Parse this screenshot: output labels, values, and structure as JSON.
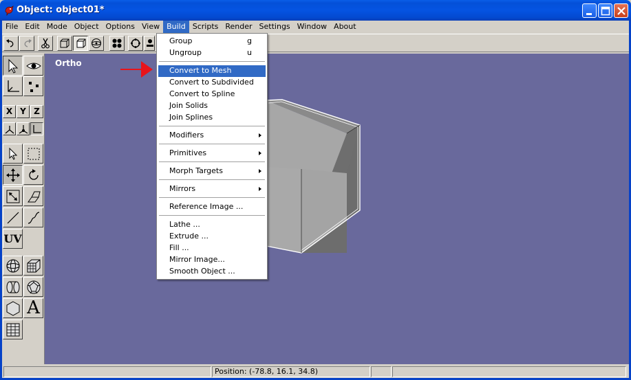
{
  "window": {
    "title": "Object: object01*",
    "icon": "bird-app-icon",
    "controls": [
      "minimize-icon",
      "maximize-icon",
      "close-icon"
    ]
  },
  "menubar": {
    "items": [
      {
        "label": "File"
      },
      {
        "label": "Edit"
      },
      {
        "label": "Mode"
      },
      {
        "label": "Object"
      },
      {
        "label": "Options"
      },
      {
        "label": "View"
      },
      {
        "label": "Build",
        "active": true
      },
      {
        "label": "Scripts"
      },
      {
        "label": "Render"
      },
      {
        "label": "Settings"
      },
      {
        "label": "Window"
      },
      {
        "label": "About"
      }
    ]
  },
  "toolbar": {
    "icons": [
      "undo-icon",
      "redo-icon",
      "scissors-icon",
      "box-view-icon",
      "cube-view-icon",
      "sphere-view-icon",
      "dots-icon",
      "rotate-icon",
      "paint-icon"
    ]
  },
  "palette": {
    "axis_labels": [
      "X",
      "Y",
      "Z"
    ],
    "uv_label": "UV",
    "text_tool_label": "A"
  },
  "viewport": {
    "label": "Ortho",
    "background": "#69699c"
  },
  "build_menu": {
    "items": [
      {
        "label": "Group",
        "shortcut": "g"
      },
      {
        "label": "Ungroup",
        "shortcut": "u"
      },
      {
        "label": "Convert to Mesh",
        "highlighted": true
      },
      {
        "label": "Convert to Subdivided"
      },
      {
        "label": "Convert to Spline"
      },
      {
        "label": "Join Solids"
      },
      {
        "label": "Join Splines"
      },
      {
        "label": "Modifiers",
        "submenu": true
      },
      {
        "label": "Primitives",
        "submenu": true
      },
      {
        "label": "Morph Targets",
        "submenu": true
      },
      {
        "label": "Mirrors",
        "submenu": true
      },
      {
        "label": "Reference Image ..."
      },
      {
        "label": "Lathe ..."
      },
      {
        "label": "Extrude ..."
      },
      {
        "label": "Fill ..."
      },
      {
        "label": "Mirror Image..."
      },
      {
        "label": "Smooth Object ..."
      }
    ]
  },
  "statusbar": {
    "position": "Position: (-78.8, 16.1, 34.8)"
  },
  "colors": {
    "highlight": "#316ac5",
    "annotation_arrow": "#e8141a"
  }
}
